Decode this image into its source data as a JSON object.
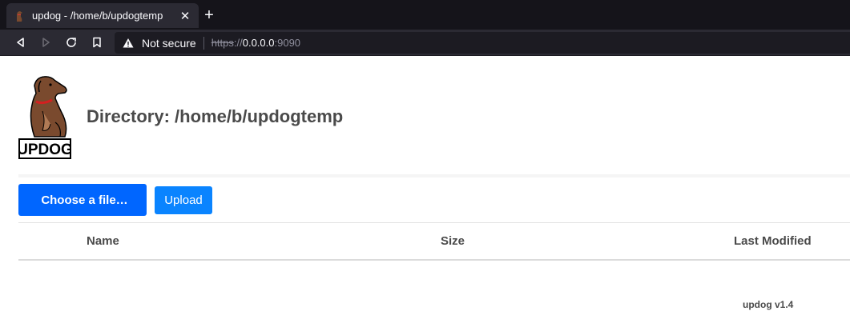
{
  "browser": {
    "tab_title": "updog - /home/b/updogtemp",
    "tab_close": "✕",
    "new_tab": "+",
    "security_label": "Not secure",
    "url_scheme": "https",
    "url_separator": "://",
    "url_host": "0.0.0.0",
    "url_port": ":9090"
  },
  "page": {
    "logo_text": "UPDOG",
    "title": "Directory: /home/b/updogtemp",
    "choose_file_icon": "",
    "choose_file_label": "Choose a file…",
    "upload_label": "Upload",
    "table": {
      "columns": [
        "Name",
        "Size",
        "Last Modified"
      ],
      "rows": []
    },
    "footer_version": "updog v1.4"
  },
  "colors": {
    "primary_button": "#0066ff",
    "upload_button": "#0a84ff",
    "text": "#4a4a4a"
  }
}
